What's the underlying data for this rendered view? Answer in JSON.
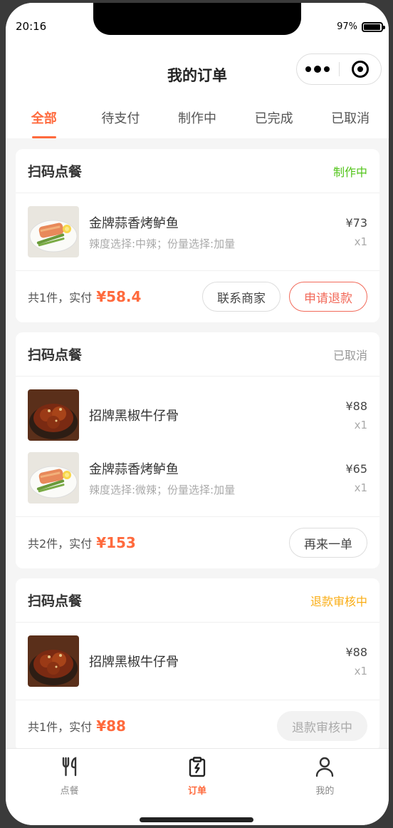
{
  "status_bar": {
    "time": "20:16",
    "battery": "97%"
  },
  "navbar": {
    "title": "我的订单"
  },
  "tabs": [
    {
      "label": "全部",
      "active": true
    },
    {
      "label": "待支付"
    },
    {
      "label": "制作中"
    },
    {
      "label": "已完成"
    },
    {
      "label": "已取消"
    }
  ],
  "orders": [
    {
      "title": "扫码点餐",
      "status": "制作中",
      "status_color": "#52c41a",
      "items": [
        {
          "name": "金牌蒜香烤鲈鱼",
          "spec": "辣度选择:中辣；份量选择:加量",
          "price": "¥73",
          "qty": "x1",
          "image": "fish-dish"
        }
      ],
      "summary_text": "共1件，实付",
      "amount": "¥58.4",
      "buttons": [
        {
          "label": "联系商家",
          "style": "normal"
        },
        {
          "label": "申请退款",
          "style": "danger"
        }
      ]
    },
    {
      "title": "扫码点餐",
      "status": "已取消",
      "status_color": "#999999",
      "items": [
        {
          "name": "招牌黑椒牛仔骨",
          "spec": "",
          "price": "¥88",
          "qty": "x1",
          "image": "beef-rib-dish"
        },
        {
          "name": "金牌蒜香烤鲈鱼",
          "spec": "辣度选择:微辣；份量选择:加量",
          "price": "¥65",
          "qty": "x1",
          "image": "fish-dish"
        }
      ],
      "summary_text": "共2件，实付",
      "amount": "¥153",
      "buttons": [
        {
          "label": "再来一单",
          "style": "normal"
        }
      ]
    },
    {
      "title": "扫码点餐",
      "status": "退款审核中",
      "status_color": "#faad14",
      "items": [
        {
          "name": "招牌黑椒牛仔骨",
          "spec": "",
          "price": "¥88",
          "qty": "x1",
          "image": "beef-rib-dish"
        }
      ],
      "summary_text": "共1件，实付",
      "amount": "¥88",
      "buttons": [
        {
          "label": "退款审核中",
          "style": "disabled"
        }
      ]
    }
  ],
  "tabbar": [
    {
      "label": "点餐",
      "icon": "fork-knife-icon",
      "active": false
    },
    {
      "label": "订单",
      "icon": "order-clipboard-icon",
      "active": true
    },
    {
      "label": "我的",
      "icon": "user-icon",
      "active": false
    }
  ],
  "colors": {
    "accent": "#ff6a3d",
    "danger": "#f26a5a"
  }
}
